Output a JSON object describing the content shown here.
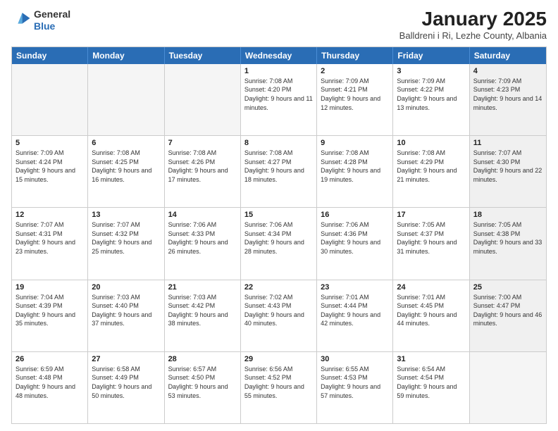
{
  "header": {
    "logo_general": "General",
    "logo_blue": "Blue",
    "month_title": "January 2025",
    "location": "Balldreni i Ri, Lezhe County, Albania"
  },
  "days_of_week": [
    "Sunday",
    "Monday",
    "Tuesday",
    "Wednesday",
    "Thursday",
    "Friday",
    "Saturday"
  ],
  "weeks": [
    [
      {
        "day": "",
        "info": "",
        "empty": true
      },
      {
        "day": "",
        "info": "",
        "empty": true
      },
      {
        "day": "",
        "info": "",
        "empty": true
      },
      {
        "day": "1",
        "info": "Sunrise: 7:08 AM\nSunset: 4:20 PM\nDaylight: 9 hours and 11 minutes.",
        "empty": false
      },
      {
        "day": "2",
        "info": "Sunrise: 7:09 AM\nSunset: 4:21 PM\nDaylight: 9 hours and 12 minutes.",
        "empty": false
      },
      {
        "day": "3",
        "info": "Sunrise: 7:09 AM\nSunset: 4:22 PM\nDaylight: 9 hours and 13 minutes.",
        "empty": false
      },
      {
        "day": "4",
        "info": "Sunrise: 7:09 AM\nSunset: 4:23 PM\nDaylight: 9 hours and 14 minutes.",
        "empty": false,
        "shaded": true
      }
    ],
    [
      {
        "day": "5",
        "info": "Sunrise: 7:09 AM\nSunset: 4:24 PM\nDaylight: 9 hours and 15 minutes.",
        "empty": false
      },
      {
        "day": "6",
        "info": "Sunrise: 7:08 AM\nSunset: 4:25 PM\nDaylight: 9 hours and 16 minutes.",
        "empty": false
      },
      {
        "day": "7",
        "info": "Sunrise: 7:08 AM\nSunset: 4:26 PM\nDaylight: 9 hours and 17 minutes.",
        "empty": false
      },
      {
        "day": "8",
        "info": "Sunrise: 7:08 AM\nSunset: 4:27 PM\nDaylight: 9 hours and 18 minutes.",
        "empty": false
      },
      {
        "day": "9",
        "info": "Sunrise: 7:08 AM\nSunset: 4:28 PM\nDaylight: 9 hours and 19 minutes.",
        "empty": false
      },
      {
        "day": "10",
        "info": "Sunrise: 7:08 AM\nSunset: 4:29 PM\nDaylight: 9 hours and 21 minutes.",
        "empty": false
      },
      {
        "day": "11",
        "info": "Sunrise: 7:07 AM\nSunset: 4:30 PM\nDaylight: 9 hours and 22 minutes.",
        "empty": false,
        "shaded": true
      }
    ],
    [
      {
        "day": "12",
        "info": "Sunrise: 7:07 AM\nSunset: 4:31 PM\nDaylight: 9 hours and 23 minutes.",
        "empty": false
      },
      {
        "day": "13",
        "info": "Sunrise: 7:07 AM\nSunset: 4:32 PM\nDaylight: 9 hours and 25 minutes.",
        "empty": false
      },
      {
        "day": "14",
        "info": "Sunrise: 7:06 AM\nSunset: 4:33 PM\nDaylight: 9 hours and 26 minutes.",
        "empty": false
      },
      {
        "day": "15",
        "info": "Sunrise: 7:06 AM\nSunset: 4:34 PM\nDaylight: 9 hours and 28 minutes.",
        "empty": false
      },
      {
        "day": "16",
        "info": "Sunrise: 7:06 AM\nSunset: 4:36 PM\nDaylight: 9 hours and 30 minutes.",
        "empty": false
      },
      {
        "day": "17",
        "info": "Sunrise: 7:05 AM\nSunset: 4:37 PM\nDaylight: 9 hours and 31 minutes.",
        "empty": false
      },
      {
        "day": "18",
        "info": "Sunrise: 7:05 AM\nSunset: 4:38 PM\nDaylight: 9 hours and 33 minutes.",
        "empty": false,
        "shaded": true
      }
    ],
    [
      {
        "day": "19",
        "info": "Sunrise: 7:04 AM\nSunset: 4:39 PM\nDaylight: 9 hours and 35 minutes.",
        "empty": false
      },
      {
        "day": "20",
        "info": "Sunrise: 7:03 AM\nSunset: 4:40 PM\nDaylight: 9 hours and 37 minutes.",
        "empty": false
      },
      {
        "day": "21",
        "info": "Sunrise: 7:03 AM\nSunset: 4:42 PM\nDaylight: 9 hours and 38 minutes.",
        "empty": false
      },
      {
        "day": "22",
        "info": "Sunrise: 7:02 AM\nSunset: 4:43 PM\nDaylight: 9 hours and 40 minutes.",
        "empty": false
      },
      {
        "day": "23",
        "info": "Sunrise: 7:01 AM\nSunset: 4:44 PM\nDaylight: 9 hours and 42 minutes.",
        "empty": false
      },
      {
        "day": "24",
        "info": "Sunrise: 7:01 AM\nSunset: 4:45 PM\nDaylight: 9 hours and 44 minutes.",
        "empty": false
      },
      {
        "day": "25",
        "info": "Sunrise: 7:00 AM\nSunset: 4:47 PM\nDaylight: 9 hours and 46 minutes.",
        "empty": false,
        "shaded": true
      }
    ],
    [
      {
        "day": "26",
        "info": "Sunrise: 6:59 AM\nSunset: 4:48 PM\nDaylight: 9 hours and 48 minutes.",
        "empty": false
      },
      {
        "day": "27",
        "info": "Sunrise: 6:58 AM\nSunset: 4:49 PM\nDaylight: 9 hours and 50 minutes.",
        "empty": false
      },
      {
        "day": "28",
        "info": "Sunrise: 6:57 AM\nSunset: 4:50 PM\nDaylight: 9 hours and 53 minutes.",
        "empty": false
      },
      {
        "day": "29",
        "info": "Sunrise: 6:56 AM\nSunset: 4:52 PM\nDaylight: 9 hours and 55 minutes.",
        "empty": false
      },
      {
        "day": "30",
        "info": "Sunrise: 6:55 AM\nSunset: 4:53 PM\nDaylight: 9 hours and 57 minutes.",
        "empty": false
      },
      {
        "day": "31",
        "info": "Sunrise: 6:54 AM\nSunset: 4:54 PM\nDaylight: 9 hours and 59 minutes.",
        "empty": false
      },
      {
        "day": "",
        "info": "",
        "empty": true,
        "shaded": true
      }
    ]
  ]
}
